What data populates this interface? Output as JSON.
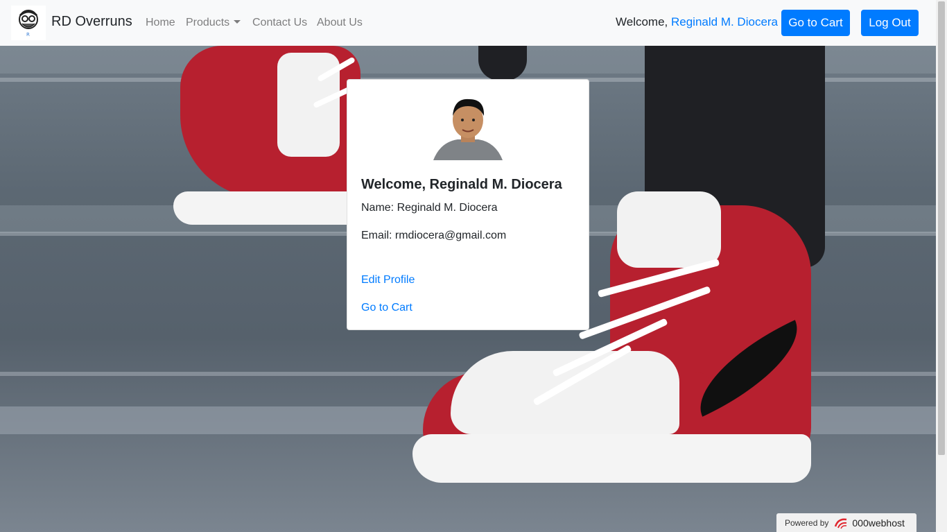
{
  "navbar": {
    "brand_name": "RD Overruns",
    "links": {
      "home": "Home",
      "products": "Products",
      "contact": "Contact Us",
      "about": "About Us"
    },
    "welcome_prefix": "Welcome,",
    "user_name": "Reginald M. Diocera",
    "cart_button": "Go to Cart",
    "logout_button": "Log Out"
  },
  "profile_card": {
    "title": "Welcome, Reginald M. Diocera",
    "name_line": "Name: Reginald M. Diocera",
    "email_line": "Email: rmdiocera@gmail.com",
    "edit_link": "Edit Profile",
    "cart_link": "Go to Cart"
  },
  "footer_badge": {
    "prefix": "Powered by",
    "brand": "000webhost"
  },
  "colors": {
    "primary": "#007bff",
    "navbar_bg": "#f8f9fa",
    "text": "#212529"
  }
}
